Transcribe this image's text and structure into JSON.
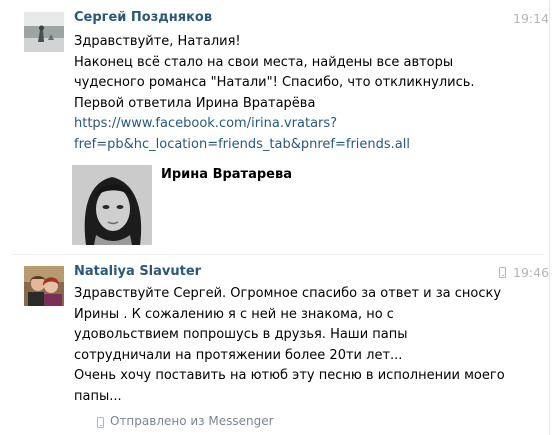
{
  "message1": {
    "author": "Сергей Поздняков",
    "time": "19:14",
    "lines": [
      "Здравствуйте, Наталия!",
      "Наконец всё стало на свои места, найдены все авторы",
      "чудесного романса \"Натали\"! Спасибо, что откликнулись.",
      "Первой ответила Ирина Вратарёва"
    ],
    "link_lines": [
      "https://www.facebook.com/irina.vratars?",
      "fref=pb&hc_location=friends_tab&pnref=friends.all"
    ],
    "share": {
      "name": "Ирина Вратарева"
    }
  },
  "message2": {
    "author": "Nataliya Slavuter",
    "time": "19:46",
    "lines": [
      "Здравствуйте Сергей. Огромное спасибо  за ответ и за сноску",
      "Ирины . К сожалению я с ней не знакома, но с",
      "удовольствием попрошусь в друзья. Наши папы",
      "сотрудничали на протяжении более 20ти лет...",
      "Очень хочу поставить на ютюб эту песню в исполнении моего",
      "папы..."
    ],
    "sent_from": "Отправлено из Messenger"
  },
  "icons": {
    "phone": "mobile-phone-icon"
  },
  "colors": {
    "author": "#2b587a",
    "link": "#2b587a",
    "time": "#b0b6bd"
  }
}
